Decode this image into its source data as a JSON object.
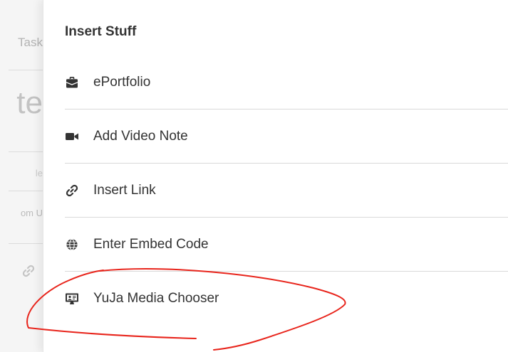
{
  "background": {
    "tab_label": "Task",
    "heading_fragment": "te",
    "field1_fragment": "le",
    "field2_fragment": "om U",
    "link_icon": "link-icon"
  },
  "panel": {
    "title": "Insert Stuff",
    "items": [
      {
        "label": "ePortfolio",
        "icon": "briefcase-icon"
      },
      {
        "label": "Add Video Note",
        "icon": "video-camera-icon"
      },
      {
        "label": "Insert Link",
        "icon": "link-icon"
      },
      {
        "label": "Enter Embed Code",
        "icon": "globe-icon"
      },
      {
        "label": "YuJa Media Chooser",
        "icon": "monitor-presentation-icon"
      }
    ]
  },
  "colors": {
    "text": "#333333",
    "divider": "#d9d9d9",
    "annotation": "#e8241b",
    "background_page": "#f5f5f5"
  }
}
